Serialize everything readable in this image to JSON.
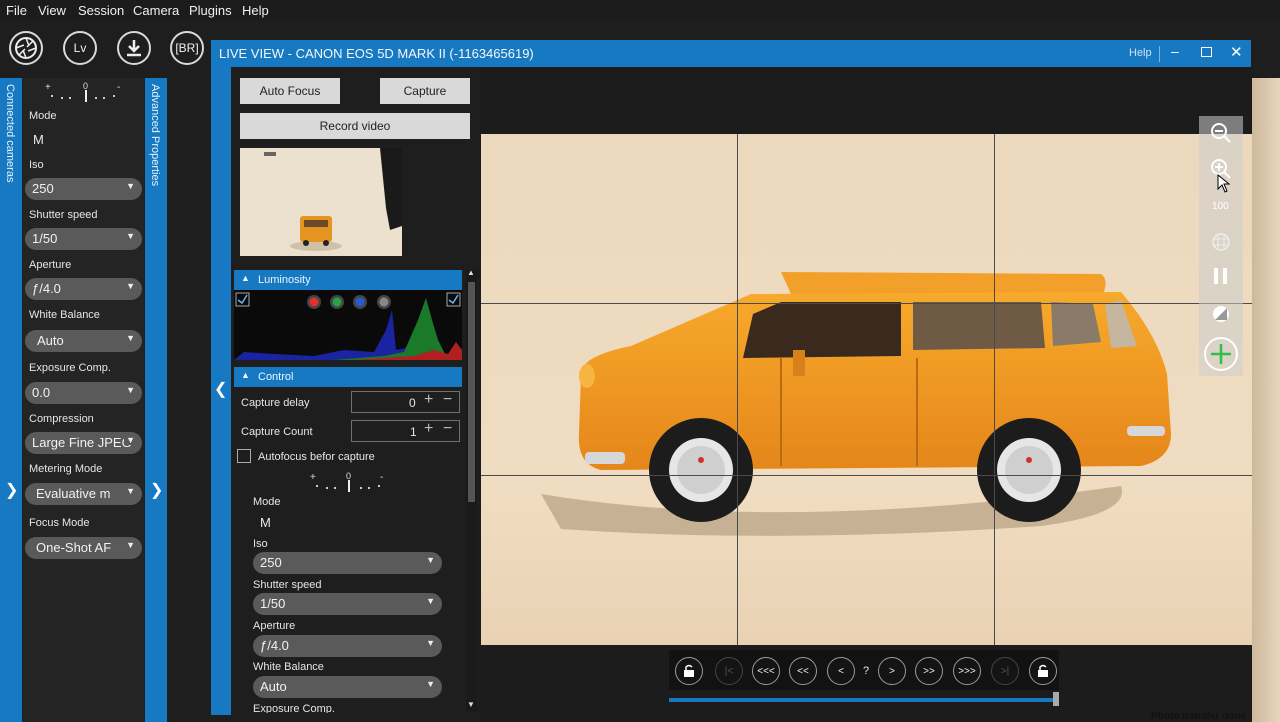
{
  "menu": [
    "File",
    "View",
    "Session",
    "Camera",
    "Plugins",
    "Help"
  ],
  "toolbar": {
    "lv_label": "Lv",
    "br_label": "[BR]"
  },
  "left_strip_label": "Connected cameras",
  "adv_strip_label": "Advanced Properties",
  "left_panel": {
    "mode_label": "Mode",
    "mode_value": "M",
    "iso_label": "Iso",
    "iso_value": "250",
    "shutter_label": "Shutter speed",
    "shutter_value": "1/50",
    "aperture_label": "Aperture",
    "aperture_value": "ƒ/4.0",
    "wb_label": "White Balance",
    "wb_value": "Auto",
    "ev_label": "Exposure Comp.",
    "ev_value": "0.0",
    "compression_label": "Compression",
    "compression_value": "Large Fine JPEG",
    "metering_label": "Metering Mode",
    "metering_value": "Evaluative m",
    "focus_label": "Focus Mode",
    "focus_value": "One-Shot AF"
  },
  "liveview": {
    "title": "LIVE VIEW - CANON EOS 5D MARK II (-1163465619)",
    "help": "Help",
    "auto_focus": "Auto Focus",
    "capture": "Capture",
    "record_video": "Record video",
    "luminosity": "Luminosity",
    "control": "Control",
    "capture_delay_label": "Capture delay",
    "capture_delay_value": "0",
    "capture_count_label": "Capture Count",
    "capture_count_value": "1",
    "autofocus_label": "Autofocus befor capture",
    "mode_label": "Mode",
    "mode_value": "M",
    "iso_label": "Iso",
    "iso_value": "250",
    "shutter_label": "Shutter speed",
    "shutter_value": "1/50",
    "aperture_label": "Aperture",
    "aperture_value": "ƒ/4.0",
    "wb_label": "White Balance",
    "wb_value": "Auto",
    "ev_label": "Exposure Comp.",
    "zoom_level": "100",
    "nav_counter": "?",
    "status": "Photo transfer done"
  },
  "nav": {
    "first": "|<",
    "prev3": "<<<",
    "prev2": "<<",
    "prev": "<",
    "next": ">",
    "next2": ">>",
    "next3": ">>>",
    "last": ">|"
  },
  "colors": {
    "accent": "#1679c1",
    "panel": "#242424",
    "combo": "#5a5a5a",
    "car": "#f39a1e",
    "wall": "#efdcc0"
  }
}
